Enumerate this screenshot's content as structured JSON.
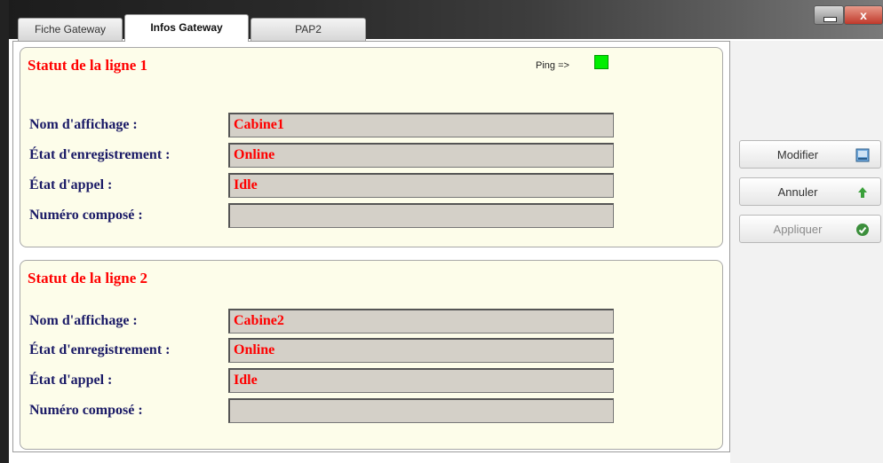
{
  "tabs": [
    {
      "label": "Fiche Gateway"
    },
    {
      "label": "Infos Gateway"
    },
    {
      "label": "PAP2"
    }
  ],
  "window_controls": {
    "close_label": "x"
  },
  "ping": {
    "label": "Ping =>",
    "status_color": "#00ee00"
  },
  "line1": {
    "title": "Statut de la ligne 1",
    "fields": [
      {
        "label": "Nom d'affichage :",
        "value": "Cabine1"
      },
      {
        "label": "État d'enregistrement :",
        "value": "Online"
      },
      {
        "label": "État d'appel :",
        "value": "Idle"
      },
      {
        "label": "Numéro composé :",
        "value": ""
      }
    ]
  },
  "line2": {
    "title": "Statut de la ligne 2",
    "fields": [
      {
        "label": "Nom d'affichage :",
        "value": "Cabine2"
      },
      {
        "label": "État d'enregistrement :",
        "value": "Online"
      },
      {
        "label": "État d'appel :",
        "value": "Idle"
      },
      {
        "label": "Numéro composé :",
        "value": ""
      }
    ]
  },
  "actions": {
    "modify_label": "Modifier",
    "cancel_label": "Annuler",
    "apply_label": "Appliquer"
  },
  "colors": {
    "title_red": "#ff0000",
    "label_navy": "#1a1a66",
    "panel_bg": "#fdfdea",
    "field_bg": "#d4d0c8"
  }
}
